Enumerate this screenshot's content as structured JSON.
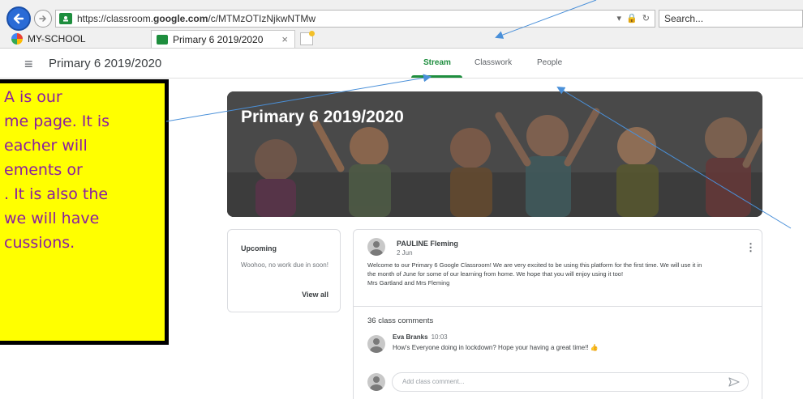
{
  "browser": {
    "url_prefix": "https://classroom.",
    "url_domain": "google.com",
    "url_path": "/c/MTMzOTIzNjkwNTMw",
    "search_placeholder": "Search...",
    "tabs": [
      {
        "label": "MY-SCHOOL"
      },
      {
        "label": "Primary 6 2019/2020",
        "close": "×"
      }
    ]
  },
  "classroom": {
    "menu_icon": "≡",
    "title": "Primary 6 2019/2020",
    "tabs": [
      {
        "label": "Stream",
        "active": true
      },
      {
        "label": "Classwork"
      },
      {
        "label": "People"
      }
    ],
    "banner_title": "Primary 6 2019/2020"
  },
  "upcoming": {
    "title": "Upcoming",
    "text": "Woohoo, no work due in soon!",
    "link": "View all"
  },
  "post": {
    "author": "PAULINE Fleming",
    "date": "2 Jun",
    "menu": "⋮",
    "body": [
      "Welcome to our Primary 6 Google Classroom! We are very excited to be using this platform for the first time. We will use it in",
      "the month of June for some of our learning from home. We hope that you will enjoy using it too!",
      "Mrs Gartland and Mrs Fleming"
    ],
    "comments_count": "36 class comments",
    "comment": {
      "author": "Eva Branks",
      "time": "10:03",
      "text": "How's Everyone doing in lockdown? Hope your having a great time!! 👍"
    },
    "add_comment_placeholder": "Add class comment..."
  },
  "annotation": {
    "lines": [
      "A is our",
      "me page. It is",
      "eacher will",
      "ements or",
      ". It is also the",
      "we will have",
      "cussions."
    ]
  },
  "colors": {
    "accent_green": "#1e8e3e",
    "note_bg": "#ffff00",
    "note_text": "#8a1ea0",
    "arrow": "#4a90d9"
  }
}
